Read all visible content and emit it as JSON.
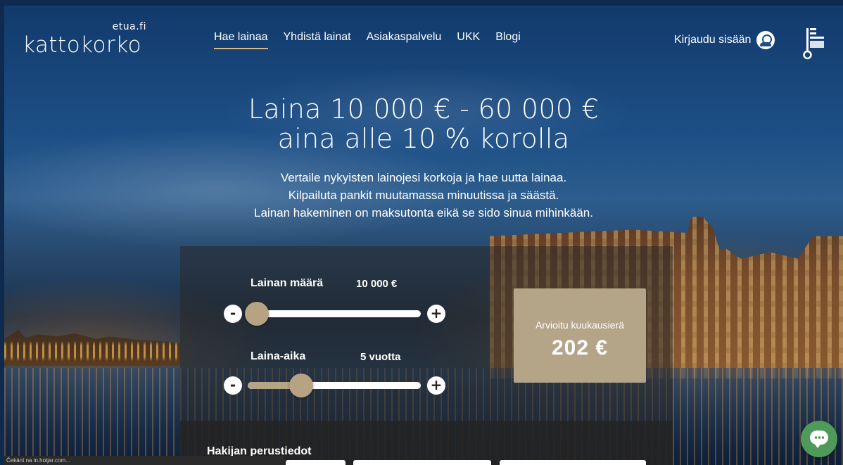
{
  "logo": {
    "sub": "etua.fi",
    "main": "kattokorko"
  },
  "nav": {
    "items": [
      {
        "label": "Hae lainaa",
        "active": true
      },
      {
        "label": "Yhdistä lainat",
        "active": false
      },
      {
        "label": "Asiakaspalvelu",
        "active": false
      },
      {
        "label": "UKK",
        "active": false
      },
      {
        "label": "Blogi",
        "active": false
      }
    ]
  },
  "header": {
    "login_label": "Kirjaudu sisään",
    "user_icon": "user-circle-icon",
    "badge_icon": "key-flag-badge-icon"
  },
  "hero": {
    "title_line1": "Laina 10 000 € - 60 000 €",
    "title_line2": "aina alle 10 % korolla",
    "sub_line1": "Vertaile nykyisten lainojesi korkoja ja hae uutta lainaa.",
    "sub_line2": "Kilpailuta pankit muutamassa minuutissa ja säästä.",
    "sub_line3": "Lainan hakeminen on maksutonta eikä se sido sinua mihinkään."
  },
  "calculator": {
    "amount": {
      "label": "Lainan määrä",
      "value": "10 000 €",
      "level": 0.0
    },
    "term": {
      "label": "Laina-aika",
      "value": "5 vuotta",
      "level": 0.27
    },
    "minus_symbol": "-",
    "plus_symbol": "+",
    "monthly": {
      "label": "Arvioitu kuukausierä",
      "value": "202 €"
    },
    "applicant_title": "Hakijan perustiedot"
  },
  "statusbar": {
    "text": "Čekání na in.hotjar.com..."
  },
  "colors": {
    "accent": "#b7a283",
    "nav_underline": "#d6b889",
    "chat": "#4f9a5b"
  }
}
